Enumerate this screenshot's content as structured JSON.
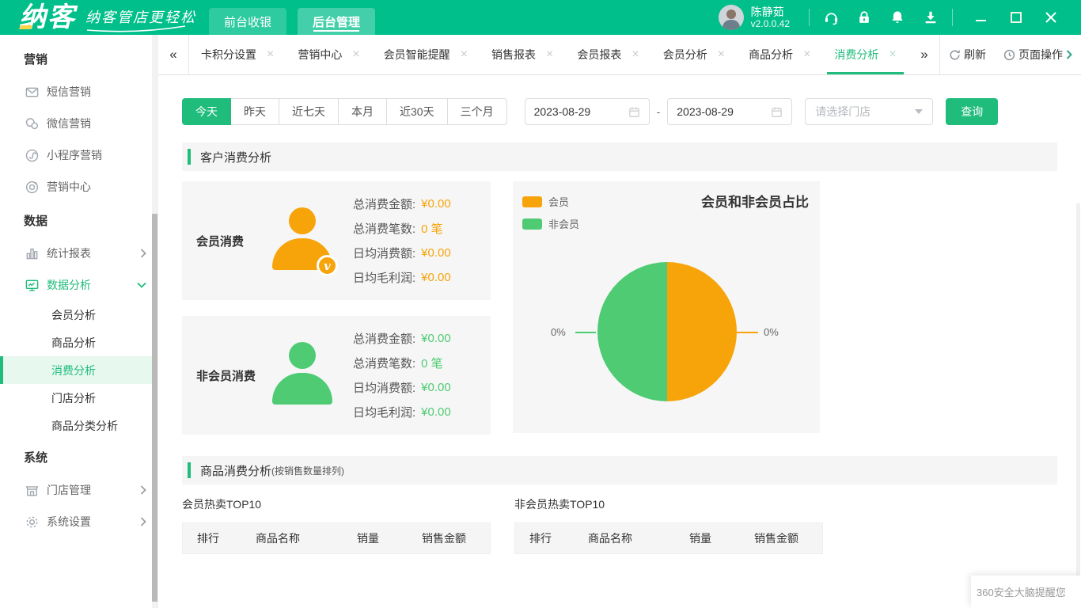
{
  "colors": {
    "brand_green": "#00bf8b",
    "accent_green": "#1fbc7c",
    "orange": "#f7a40a",
    "pie_green": "#4ecb73"
  },
  "header": {
    "logo_text": "纳客",
    "tagline": "纳客管店更轻松",
    "nav": [
      {
        "label": "前台收银",
        "active": false
      },
      {
        "label": "后台管理",
        "active": true
      }
    ],
    "user": {
      "name": "陈静茹",
      "version": "v2.0.0.42"
    }
  },
  "tabbar": {
    "collapse_left": "«",
    "collapse_right": "»",
    "tabs": [
      {
        "label": "卡积分设置",
        "active": false
      },
      {
        "label": "营销中心",
        "active": false
      },
      {
        "label": "会员智能提醒",
        "active": false
      },
      {
        "label": "销售报表",
        "active": false
      },
      {
        "label": "会员报表",
        "active": false
      },
      {
        "label": "会员分析",
        "active": false
      },
      {
        "label": "商品分析",
        "active": false
      },
      {
        "label": "消费分析",
        "active": true
      }
    ],
    "close_glyph": "×",
    "refresh_label": "刷新",
    "page_ops_label": "页面操作"
  },
  "sidebar": {
    "sections": [
      {
        "title": "营销",
        "items": [
          {
            "label": "短信营销",
            "icon": "mail-icon"
          },
          {
            "label": "微信营销",
            "icon": "wechat-icon"
          },
          {
            "label": "小程序营销",
            "icon": "miniprogram-icon"
          },
          {
            "label": "营销中心",
            "icon": "target-icon"
          }
        ]
      },
      {
        "title": "数据",
        "items": [
          {
            "label": "统计报表",
            "icon": "bar-chart-icon",
            "chevron": "right"
          },
          {
            "label": "数据分析",
            "icon": "analytics-icon",
            "chevron": "down",
            "expanded": true,
            "children": [
              {
                "label": "会员分析",
                "active": false
              },
              {
                "label": "商品分析",
                "active": false
              },
              {
                "label": "消费分析",
                "active": true
              },
              {
                "label": "门店分析",
                "active": false
              },
              {
                "label": "商品分类分析",
                "active": false
              }
            ]
          }
        ]
      },
      {
        "title": "系统",
        "items": [
          {
            "label": "门店管理",
            "icon": "store-icon",
            "chevron": "right"
          },
          {
            "label": "系统设置",
            "icon": "gear-icon",
            "chevron": "right"
          }
        ]
      }
    ]
  },
  "filters": {
    "ranges": [
      {
        "label": "今天",
        "active": true
      },
      {
        "label": "昨天",
        "active": false
      },
      {
        "label": "近七天",
        "active": false
      },
      {
        "label": "本月",
        "active": false
      },
      {
        "label": "近30天",
        "active": false
      },
      {
        "label": "三个月",
        "active": false
      }
    ],
    "date_from": "2023-08-29",
    "date_separator": "-",
    "date_to": "2023-08-29",
    "store_placeholder": "请选择门店",
    "query_label": "查询"
  },
  "customer_section": {
    "title": "客户消费分析",
    "cards": [
      {
        "name": "会员消费",
        "color": "#f7a40a",
        "badge": "v",
        "stats": [
          {
            "label": "总消费金额:",
            "value": "¥0.00"
          },
          {
            "label": "总消费笔数:",
            "value": "0 笔"
          },
          {
            "label": "日均消费额:",
            "value": "¥0.00"
          },
          {
            "label": "日均毛利润:",
            "value": "¥0.00"
          }
        ]
      },
      {
        "name": "非会员消费",
        "color": "#4ecb73",
        "stats": [
          {
            "label": "总消费金额:",
            "value": "¥0.00"
          },
          {
            "label": "总消费笔数:",
            "value": "0 笔"
          },
          {
            "label": "日均消费额:",
            "value": "¥0.00"
          },
          {
            "label": "日均毛利润:",
            "value": "¥0.00"
          }
        ]
      }
    ]
  },
  "chart_data": {
    "type": "pie",
    "title": "会员和非会员占比",
    "legend": [
      "会员",
      "非会员"
    ],
    "slices": [
      {
        "label": "会员",
        "value": 0,
        "display": "0%",
        "color": "#f7a40a"
      },
      {
        "label": "非会员",
        "value": 0,
        "display": "0%",
        "color": "#4ecb73"
      }
    ]
  },
  "product_section": {
    "title": "商品消费分析",
    "subtitle": "(按销售数量排列)",
    "tables": [
      {
        "title": "会员热卖TOP10",
        "columns": [
          "排行",
          "商品名称",
          "销量",
          "销售金额"
        ],
        "rows": []
      },
      {
        "title": "非会员热卖TOP10",
        "columns": [
          "排行",
          "商品名称",
          "销量",
          "销售金额"
        ],
        "rows": []
      }
    ]
  },
  "toast": {
    "text": "360安全大脑提醒您"
  }
}
